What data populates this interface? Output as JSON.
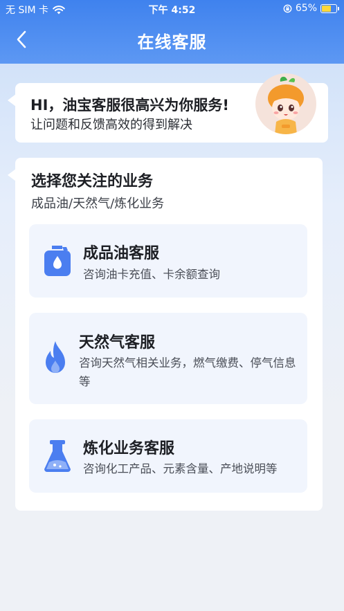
{
  "status_bar": {
    "carrier": "无 SIM 卡",
    "time": "下午 4:52",
    "battery": "65%",
    "battery_level": 0.65
  },
  "nav": {
    "title": "在线客服"
  },
  "greeting": {
    "headline": "HI，油宝客服很高兴为你服务!",
    "subline": "让问题和反馈高效的得到解决"
  },
  "services": {
    "heading": "选择您关注的业务",
    "subheading": "成品油/天然气/炼化业务",
    "items": [
      {
        "title": "成品油客服",
        "desc": "咨询油卡充值、卡余额查询",
        "icon": "oil-drop-icon"
      },
      {
        "title": "天然气客服",
        "desc": "咨询天然气相关业务，燃气缴费、停气信息等",
        "icon": "flame-icon"
      },
      {
        "title": "炼化业务客服",
        "desc": "咨询化工产品、元素含量、产地说明等",
        "icon": "flask-icon"
      }
    ]
  },
  "colors": {
    "header": "#3f82ee",
    "icon_accent": "#4b7ef0",
    "item_bg": "#f1f5fd"
  }
}
